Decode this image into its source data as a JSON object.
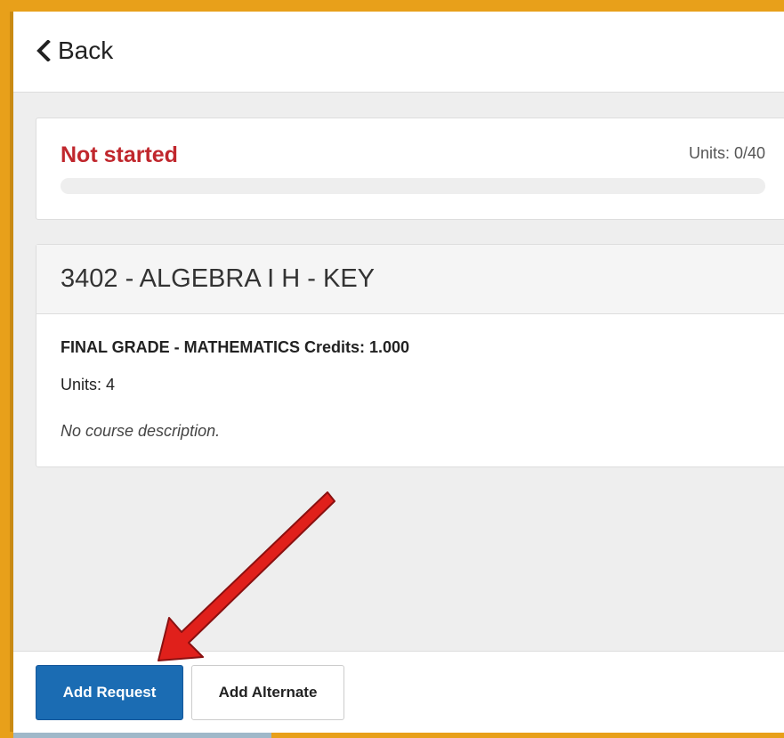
{
  "header": {
    "back_label": "Back"
  },
  "progress": {
    "status": "Not started",
    "units_label": "Units: 0/40",
    "fraction": 0
  },
  "course": {
    "title": "3402 - ALGEBRA I H - KEY",
    "grade_line": "FINAL GRADE - MATHEMATICS Credits: 1.000",
    "units_line": "Units: 4",
    "description": "No course description."
  },
  "footer": {
    "add_request_label": "Add Request",
    "add_alternate_label": "Add Alternate"
  },
  "colors": {
    "status_red": "#c0272d",
    "primary_blue": "#1b6cb3",
    "frame_orange": "#e8a01a",
    "arrow_red": "#e0201b"
  },
  "icons": {
    "back": "chevron-left-icon",
    "annotation": "red-arrow-annotation"
  }
}
